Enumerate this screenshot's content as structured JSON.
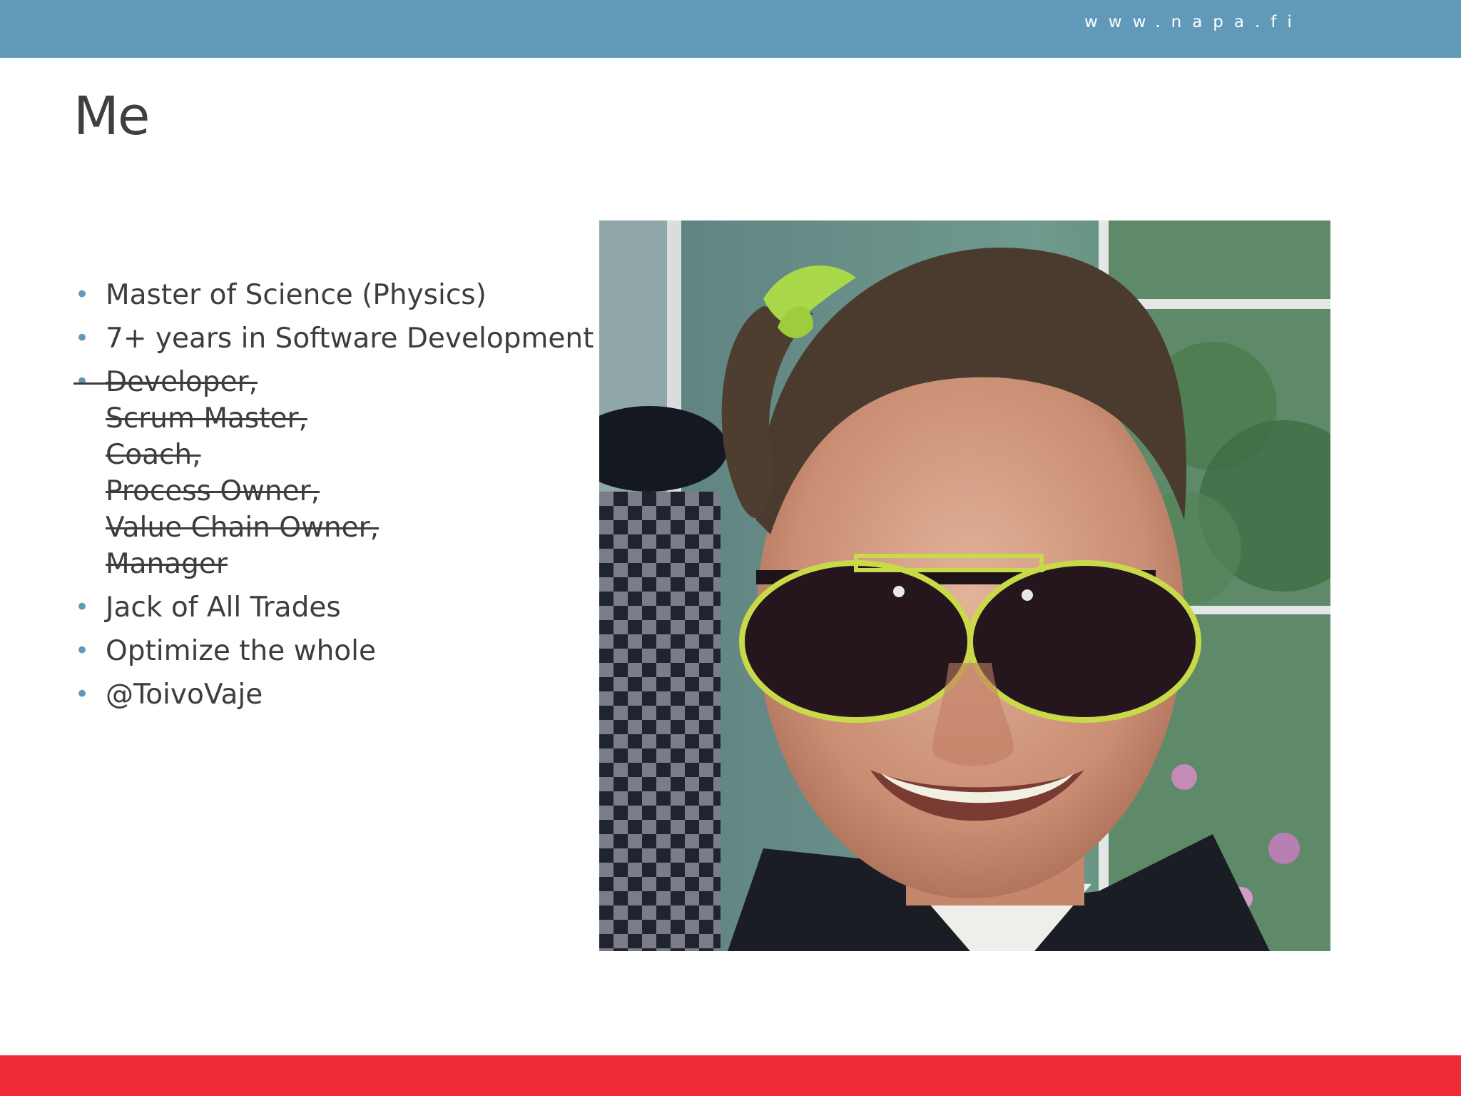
{
  "header": {
    "site_url": "www.napa.fi"
  },
  "slide": {
    "title": "Me",
    "bullets_top": [
      "Master of Science (Physics)",
      "7+ years in Software Development"
    ],
    "struck_roles": [
      "Developer,",
      "Scrum Master,",
      "Coach,",
      "Process Owner,",
      "Value Chain Owner,",
      "Manager"
    ],
    "bullets_bottom": [
      "Jack of All Trades",
      "Optimize the whole",
      "@ToivoVaje"
    ]
  },
  "colors": {
    "top_bar": "#6199b8",
    "bottom_bar": "#ee2a38",
    "bullet": "#6199b8",
    "text": "#3d3d3d"
  }
}
